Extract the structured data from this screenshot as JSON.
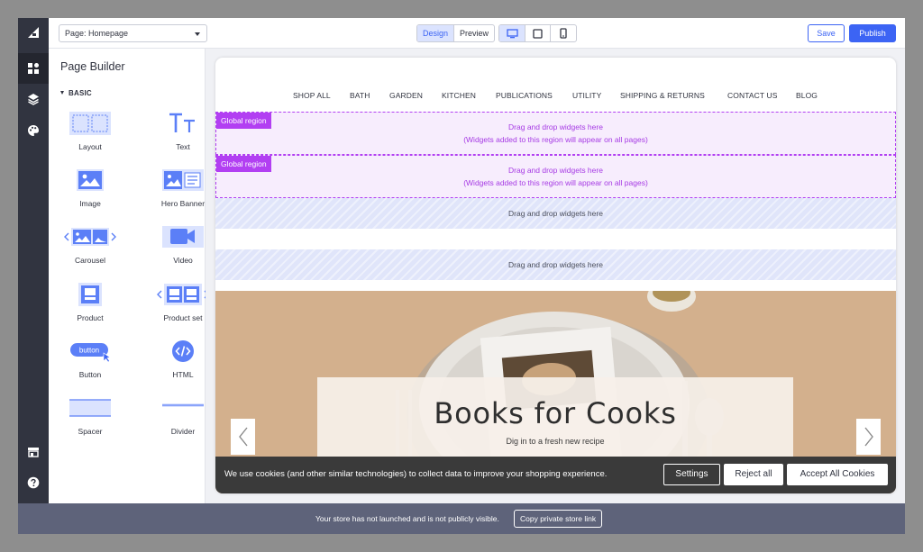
{
  "topbar": {
    "page_select": "Page: Homepage",
    "mode_tabs": [
      "Design",
      "Preview"
    ],
    "active_mode": "Design",
    "devices": [
      "desktop-icon",
      "tablet-icon",
      "mobile-icon"
    ],
    "active_device": "desktop-icon",
    "save_label": "Save",
    "publish_label": "Publish"
  },
  "rail": {
    "logo": "bigcommerce-logo",
    "items": [
      "widgets-icon",
      "layers-icon",
      "palette-icon",
      "store-icon",
      "help-icon"
    ]
  },
  "sidebar": {
    "title": "Page Builder",
    "section": "BASIC",
    "widgets": [
      {
        "label": "Layout",
        "icon": "layout-icon"
      },
      {
        "label": "Text",
        "icon": "text-icon"
      },
      {
        "label": "Image",
        "icon": "image-icon"
      },
      {
        "label": "Hero Banner",
        "icon": "hero-banner-icon"
      },
      {
        "label": "Carousel",
        "icon": "carousel-icon"
      },
      {
        "label": "Video",
        "icon": "video-icon"
      },
      {
        "label": "Product",
        "icon": "product-icon"
      },
      {
        "label": "Product set",
        "icon": "product-set-icon"
      },
      {
        "label": "Button",
        "icon": "button-icon",
        "inner": "button"
      },
      {
        "label": "HTML",
        "icon": "html-icon"
      },
      {
        "label": "Spacer",
        "icon": "spacer-icon"
      },
      {
        "label": "Divider",
        "icon": "divider-icon"
      }
    ]
  },
  "store": {
    "nav": [
      "SHOP ALL",
      "BATH",
      "GARDEN",
      "KITCHEN",
      "PUBLICATIONS",
      "UTILITY",
      "SHIPPING & RETURNS",
      "CONTACT US",
      "BLOG"
    ],
    "global_regions": [
      {
        "tag": "Global region",
        "line1": "Drag and drop widgets here",
        "line2": "(Widgets added to this region will appear on all pages)"
      },
      {
        "tag": "Global region",
        "line1": "Drag and drop widgets here",
        "line2": "(Widgets added to this region will appear on all pages)"
      }
    ],
    "drop_zones": [
      "Drag and drop widgets here",
      "Drag and drop widgets here"
    ],
    "hero": {
      "title": "Books for Cooks",
      "subtitle": "Dig in to a fresh new recipe"
    },
    "cookie": {
      "message": "We use cookies (and other similar technologies) to collect data to improve your shopping experience.",
      "settings": "Settings",
      "reject": "Reject all",
      "accept": "Accept All Cookies"
    }
  },
  "bottombar": {
    "message": "Your store has not launched and is not publicly visible.",
    "button": "Copy private store link"
  },
  "colors": {
    "accent": "#3c64f4",
    "rail": "#313440",
    "global_region": "#b23ff2",
    "bottombar": "#5e637a"
  }
}
